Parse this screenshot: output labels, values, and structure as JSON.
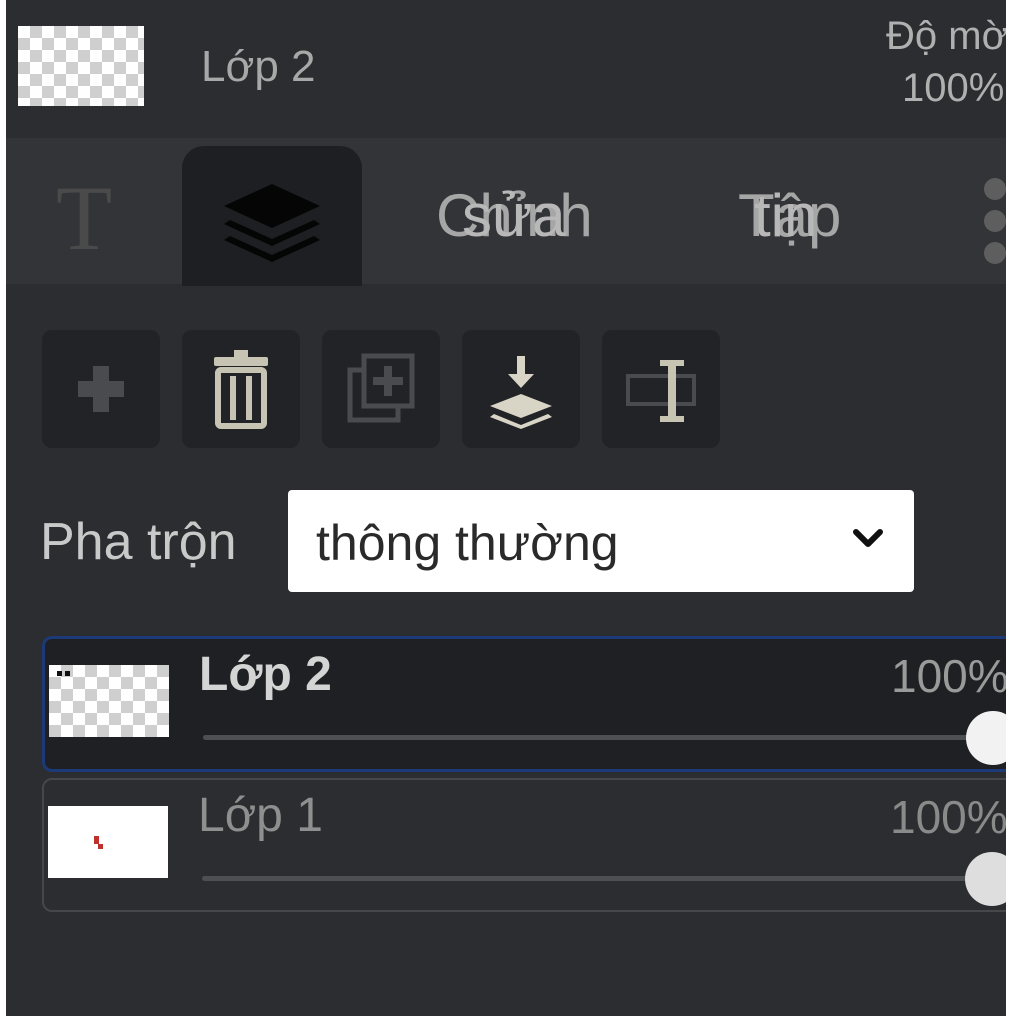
{
  "header": {
    "layer_name": "Lớp 2",
    "opacity_label": "Độ mờ",
    "opacity_value": "100%"
  },
  "tabs": {
    "text_tool_glyph": "T",
    "layers_icon": "layers-icon",
    "edit_line1": "Chỉnh",
    "edit_line2": "sửa",
    "file_line1": "Tập",
    "file_line2": "tin",
    "more_icon": "more-vertical-icon"
  },
  "toolbar": {
    "icons": [
      "plus-icon",
      "trash-icon",
      "duplicate-icon",
      "merge-down-icon",
      "rename-icon"
    ]
  },
  "blend": {
    "label": "Pha trộn",
    "selected": "thông thường"
  },
  "layers": [
    {
      "name": "Lớp 2",
      "opacity": "100%",
      "opacity_fraction": 1.0,
      "selected": true
    },
    {
      "name": "Lớp 1",
      "opacity": "100%",
      "opacity_fraction": 1.0,
      "selected": false
    }
  ],
  "colors": {
    "panel_bg": "#2b2d30",
    "selected_border": "#1c3a78",
    "icon_color": "#c8c4b4"
  }
}
